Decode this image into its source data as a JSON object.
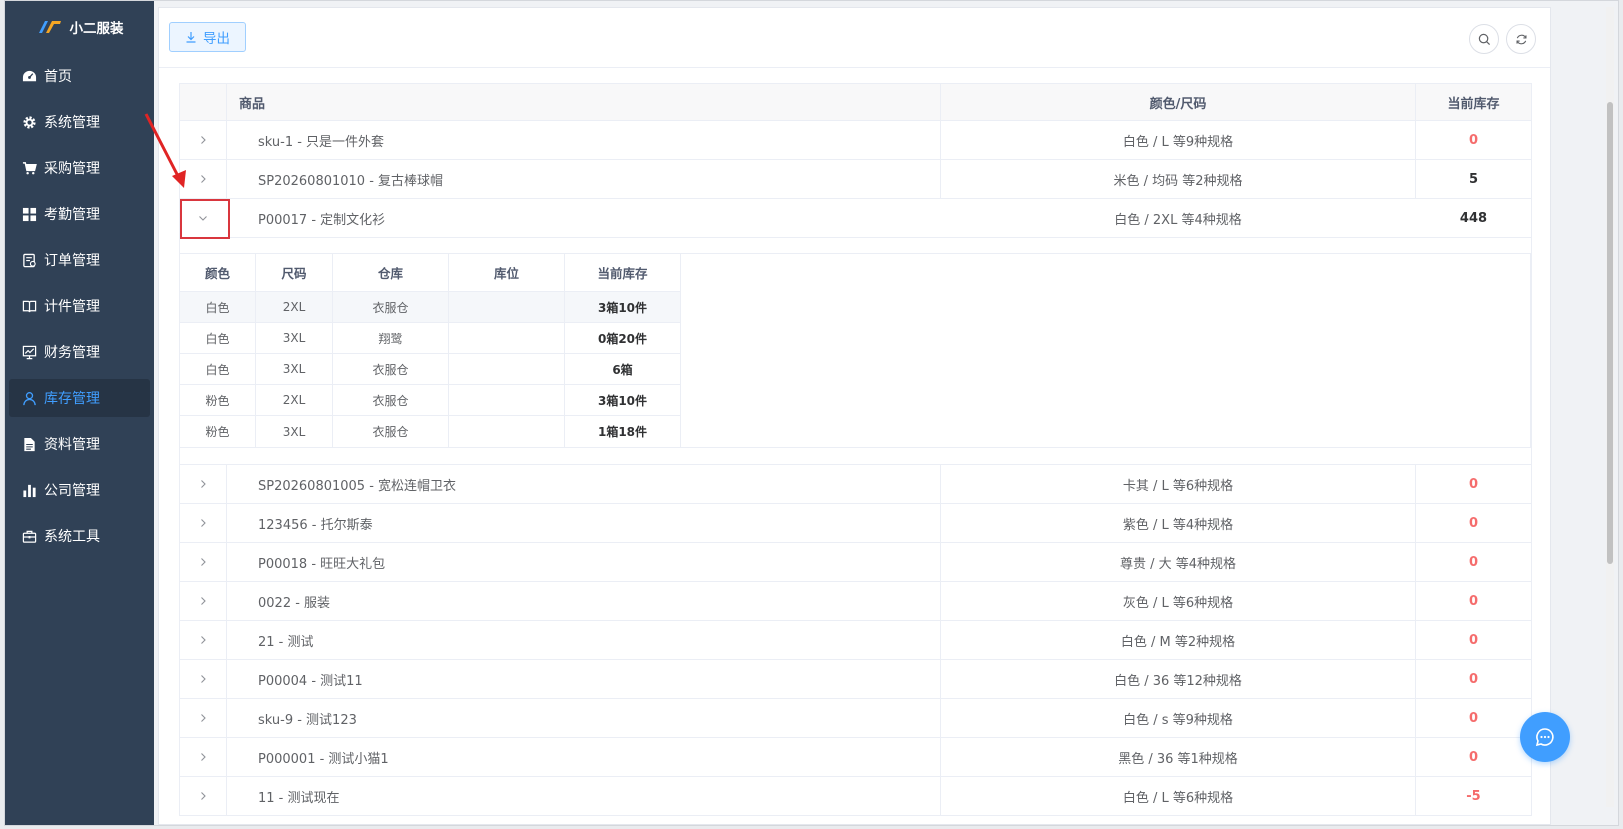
{
  "app": {
    "logo_text": "小二服装",
    "accent": "#409eff",
    "sidebar_bg": "#304156"
  },
  "sidebar": {
    "items": [
      {
        "label": "首页",
        "icon": "dashboard-icon"
      },
      {
        "label": "系统管理",
        "icon": "gear-icon"
      },
      {
        "label": "采购管理",
        "icon": "cart-icon"
      },
      {
        "label": "考勤管理",
        "icon": "grid-icon"
      },
      {
        "label": "订单管理",
        "icon": "order-icon"
      },
      {
        "label": "计件管理",
        "icon": "book-icon"
      },
      {
        "label": "财务管理",
        "icon": "chart-monitor-icon"
      },
      {
        "label": "库存管理",
        "icon": "user-icon",
        "active": true
      },
      {
        "label": "资料管理",
        "icon": "file-icon"
      },
      {
        "label": "公司管理",
        "icon": "bar-chart-icon"
      },
      {
        "label": "系统工具",
        "icon": "toolbox-icon"
      }
    ]
  },
  "toolbar": {
    "export_label": "导出",
    "search_icon": "search-icon",
    "refresh_icon": "refresh-icon"
  },
  "table": {
    "headers": {
      "product": "商品",
      "color_size": "颜色/尺码",
      "current_stock": "当前库存"
    },
    "rows": [
      {
        "product": "sku-1 - 只是一件外套",
        "color_size": "白色 / L 等9种规格",
        "stock": "0",
        "stock_color": "#f56c6c"
      },
      {
        "product": "SP20260801010 - 复古棒球帽",
        "color_size": "米色 / 均码 等2种规格",
        "stock": "5",
        "stock_color": "#303133"
      },
      {
        "product": "P00017 - 定制文化衫",
        "color_size": "白色 / 2XL 等4种规格",
        "stock": "448",
        "stock_color": "#303133",
        "expanded": true
      },
      {
        "product": "SP20260801005 - 宽松连帽卫衣",
        "color_size": "卡其 / L 等6种规格",
        "stock": "0",
        "stock_color": "#f56c6c"
      },
      {
        "product": "123456 - 托尔斯泰",
        "color_size": "紫色 / L 等4种规格",
        "stock": "0",
        "stock_color": "#f56c6c"
      },
      {
        "product": "P00018 - 旺旺大礼包",
        "color_size": "尊贵 / 大 等4种规格",
        "stock": "0",
        "stock_color": "#f56c6c"
      },
      {
        "product": "0022 - 服装",
        "color_size": "灰色 / L 等6种规格",
        "stock": "0",
        "stock_color": "#f56c6c"
      },
      {
        "product": "21 - 测试",
        "color_size": "白色 / M 等2种规格",
        "stock": "0",
        "stock_color": "#f56c6c"
      },
      {
        "product": "P00004 - 测试11",
        "color_size": "白色 / 36 等12种规格",
        "stock": "0",
        "stock_color": "#f56c6c"
      },
      {
        "product": "sku-9 - 测试123",
        "color_size": "白色 / s 等9种规格",
        "stock": "0",
        "stock_color": "#f56c6c"
      },
      {
        "product": "P000001 - 测试小猫1",
        "color_size": "黑色 / 36 等1种规格",
        "stock": "0",
        "stock_color": "#f56c6c"
      },
      {
        "product": "11 - 测试现在",
        "color_size": "白色 / L 等6种规格",
        "stock": "-5",
        "stock_color": "#f56c6c"
      }
    ]
  },
  "sub_table": {
    "headers": {
      "color": "颜色",
      "size": "尺码",
      "warehouse": "仓库",
      "location": "库位",
      "current_stock": "当前库存"
    },
    "rows": [
      {
        "color": "白色",
        "size": "2XL",
        "warehouse": "衣服仓",
        "location": "",
        "stock": "3箱10件",
        "highlight": true
      },
      {
        "color": "白色",
        "size": "3XL",
        "warehouse": "翔鹭",
        "location": "",
        "stock": "0箱20件"
      },
      {
        "color": "白色",
        "size": "3XL",
        "warehouse": "衣服仓",
        "location": "",
        "stock": "6箱"
      },
      {
        "color": "粉色",
        "size": "2XL",
        "warehouse": "衣服仓",
        "location": "",
        "stock": "3箱10件"
      },
      {
        "color": "粉色",
        "size": "3XL",
        "warehouse": "衣服仓",
        "location": "",
        "stock": "1箱18件"
      }
    ]
  },
  "annotation": {
    "color": "#d9363e"
  }
}
